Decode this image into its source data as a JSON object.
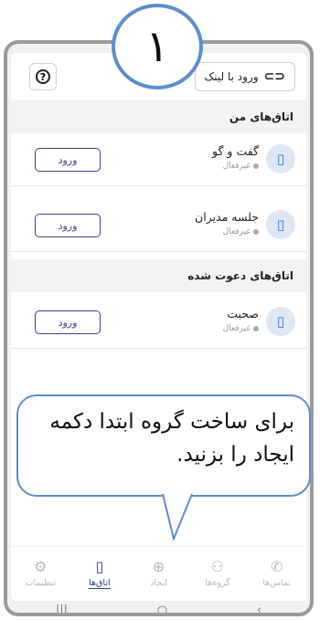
{
  "step_number": "۱",
  "topbar": {
    "link_button_label": "ورود با لینک",
    "link_icon": "link-icon",
    "help_icon": "help-icon",
    "help_glyph": "?"
  },
  "sections": {
    "my_rooms_title": "اتاق‌های من",
    "invited_rooms_title": "اتاق‌های دعوت شده"
  },
  "rooms": [
    {
      "name": "گفت و گو",
      "status": "غیرفعال",
      "enter_label": "ورود",
      "icon": "door-icon"
    },
    {
      "name": "جلسه مدیران",
      "status": "غیرفعال",
      "enter_label": "ورود",
      "icon": "door-icon"
    },
    {
      "name": "صحبت",
      "status": "غیرفعال",
      "enter_label": "ورود",
      "icon": "door-icon"
    }
  ],
  "callout": {
    "text": "برای ساخت گروه ابتدا دکمه ایجاد را بزنید."
  },
  "tabbar": [
    {
      "label": "تنظیمات",
      "icon": "gear-icon",
      "glyph": "⚙",
      "active": false
    },
    {
      "label": "اتاق‌ها",
      "icon": "door-icon",
      "glyph": "▯",
      "active": true
    },
    {
      "label": "ایجاد",
      "icon": "plus-circle-icon",
      "glyph": "⊕",
      "active": false
    },
    {
      "label": "گروه‌ها",
      "icon": "group-icon",
      "glyph": "⚇",
      "active": false
    },
    {
      "label": "تماس‌ها",
      "icon": "phone-icon",
      "glyph": "✆",
      "active": false
    }
  ],
  "system_nav": {
    "recents": "|||",
    "home": "○",
    "back": "‹"
  },
  "colors": {
    "accent": "#2c3f8c",
    "callout_border": "#5b8fd0",
    "enter_border": "#3d3f8e"
  }
}
